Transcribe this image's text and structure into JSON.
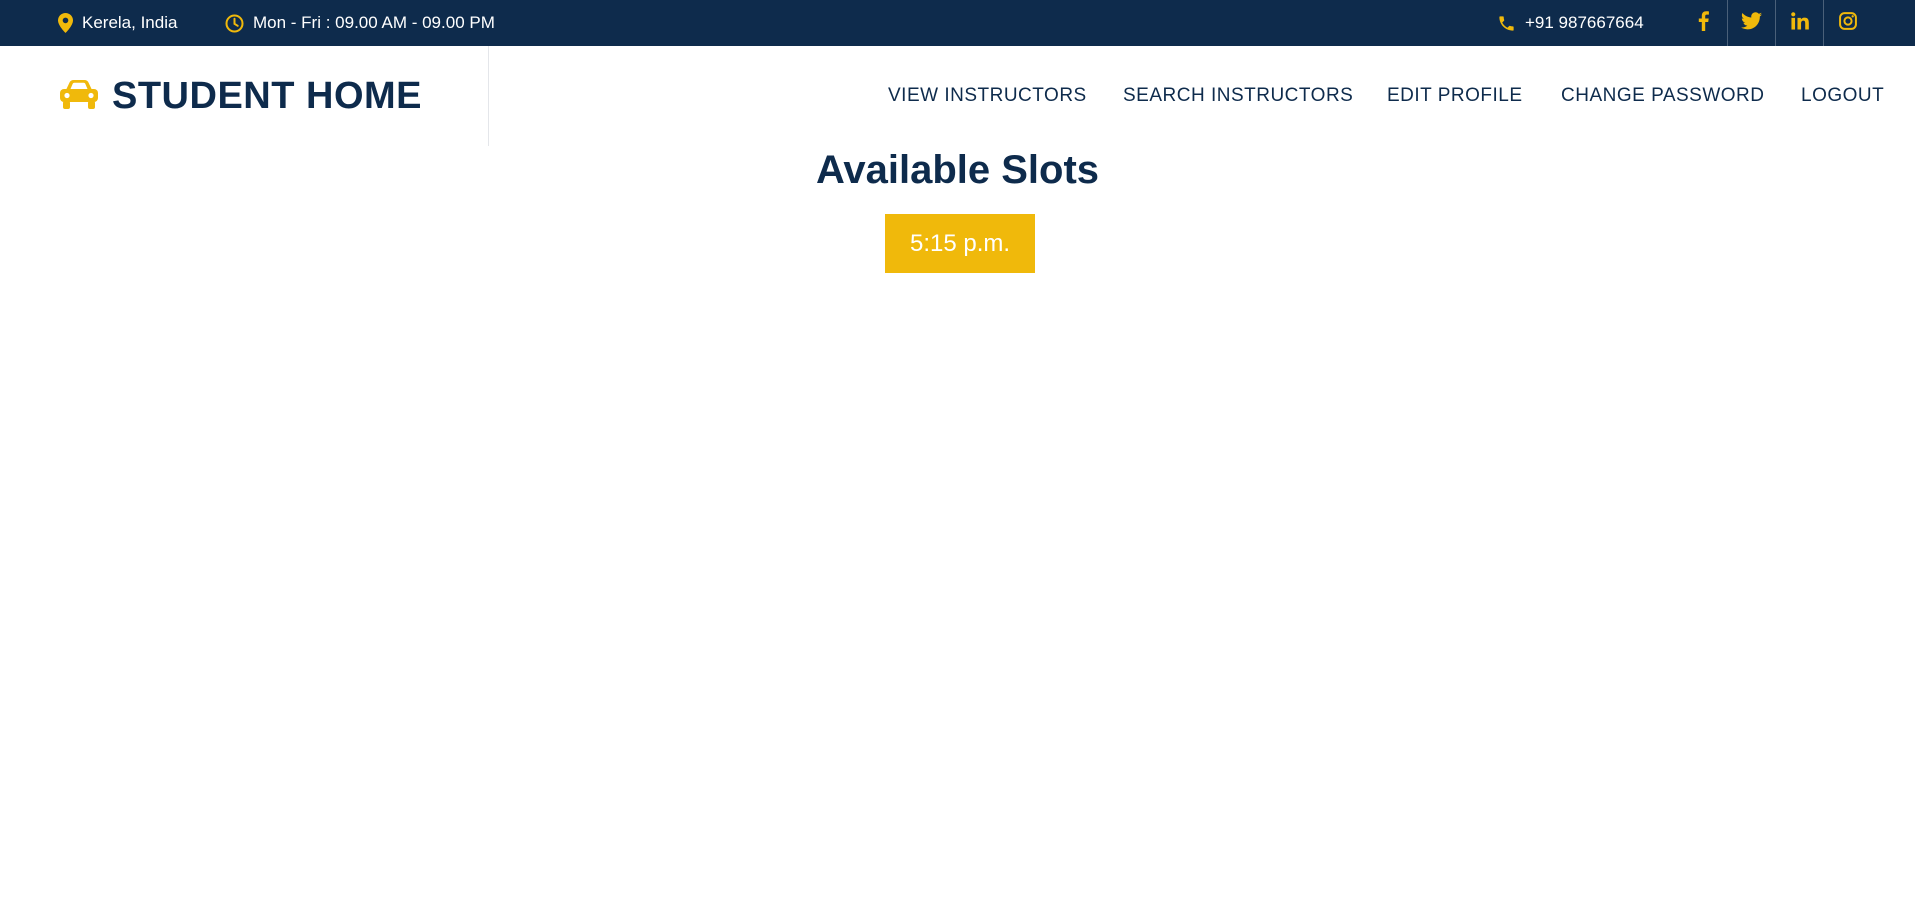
{
  "topbar": {
    "location": "Kerela, India",
    "hours": "Mon - Fri : 09.00 AM - 09.00 PM",
    "phone": "+91 987667664",
    "social": [
      "facebook-icon",
      "twitter-icon",
      "linkedin-icon",
      "instagram-icon"
    ]
  },
  "header": {
    "brand": "STUDENT HOME",
    "brand_icon": "car-icon",
    "nav": {
      "view_instructors": "VIEW INSTRUCTORS",
      "search_instructors": "SEARCH INSTRUCTORS",
      "edit_profile": "EDIT PROFILE",
      "change_password": "CHANGE PASSWORD",
      "logout": "LOGOUT"
    }
  },
  "main": {
    "title": "Available Slots",
    "slots": [
      "5:15 p.m."
    ]
  },
  "colors": {
    "primary": "#0e2b4c",
    "accent": "#f0b90b",
    "background": "#ffffff"
  }
}
